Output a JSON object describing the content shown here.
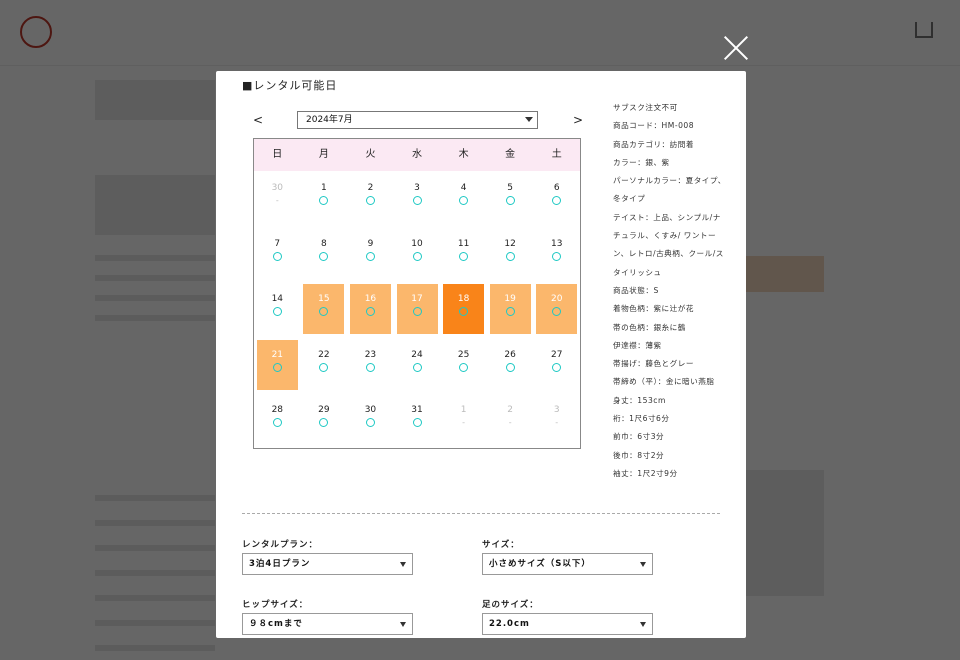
{
  "modal": {
    "title": "■レンタル可能日",
    "prev_label": "<",
    "next_label": ">",
    "month_value": "2024年7月"
  },
  "calendar": {
    "weekdays": [
      "日",
      "月",
      "火",
      "水",
      "木",
      "金",
      "土"
    ],
    "weeks": [
      [
        {
          "d": "30",
          "s": "out"
        },
        {
          "d": "1",
          "s": "avail"
        },
        {
          "d": "2",
          "s": "avail"
        },
        {
          "d": "3",
          "s": "avail"
        },
        {
          "d": "4",
          "s": "avail"
        },
        {
          "d": "5",
          "s": "avail"
        },
        {
          "d": "6",
          "s": "avail"
        }
      ],
      [
        {
          "d": "7",
          "s": "avail"
        },
        {
          "d": "8",
          "s": "avail"
        },
        {
          "d": "9",
          "s": "avail"
        },
        {
          "d": "10",
          "s": "avail"
        },
        {
          "d": "11",
          "s": "avail"
        },
        {
          "d": "12",
          "s": "avail"
        },
        {
          "d": "13",
          "s": "avail"
        }
      ],
      [
        {
          "d": "14",
          "s": "avail"
        },
        {
          "d": "15",
          "s": "range"
        },
        {
          "d": "16",
          "s": "range"
        },
        {
          "d": "17",
          "s": "range"
        },
        {
          "d": "18",
          "s": "selected"
        },
        {
          "d": "19",
          "s": "range"
        },
        {
          "d": "20",
          "s": "range"
        }
      ],
      [
        {
          "d": "21",
          "s": "range"
        },
        {
          "d": "22",
          "s": "avail"
        },
        {
          "d": "23",
          "s": "avail"
        },
        {
          "d": "24",
          "s": "avail"
        },
        {
          "d": "25",
          "s": "avail"
        },
        {
          "d": "26",
          "s": "avail"
        },
        {
          "d": "27",
          "s": "avail"
        }
      ],
      [
        {
          "d": "28",
          "s": "avail"
        },
        {
          "d": "29",
          "s": "avail"
        },
        {
          "d": "30",
          "s": "avail"
        },
        {
          "d": "31",
          "s": "avail"
        },
        {
          "d": "1",
          "s": "out"
        },
        {
          "d": "2",
          "s": "out"
        },
        {
          "d": "3",
          "s": "out"
        }
      ]
    ],
    "out_mark": "-"
  },
  "info": [
    "サブスク注文不可",
    "商品コード：HM-008",
    "商品カテゴリ：訪問着",
    "カラー：銀、紫",
    "パーソナルカラー：夏タイプ、冬タイプ",
    "テイスト：上品、シンプル/ナチュラル、くすみ/ ワントーン、レトロ/古典柄、クール/スタイリッシュ",
    "商品状態：S",
    "着物色柄：紫に辻が花",
    "帯の色柄：銀糸に鶴",
    "伊達襟：薄紫",
    "帯揚げ：藤色とグレー",
    "帯締め（平）：金に暗い燕脂",
    "身丈：153cm",
    "裄：1尺6寸6分",
    "前巾：6寸3分",
    "後巾：8寸2分",
    "袖丈：1尺2寸9分"
  ],
  "form": {
    "plan_label": "レンタルプラン：",
    "plan_value": "3泊4日プラン",
    "size_label": "サイズ：",
    "size_value": "小さめサイズ（S以下）",
    "hip_label": "ヒップサイズ：",
    "hip_value": "９８cmまで",
    "foot_label": "足のサイズ：",
    "foot_value": "22.0cm"
  },
  "colors": {
    "range": "#fbb76c",
    "selected": "#f98419",
    "available_mark": "#1fc9c4",
    "weekday_header": "#fbe9f3"
  }
}
